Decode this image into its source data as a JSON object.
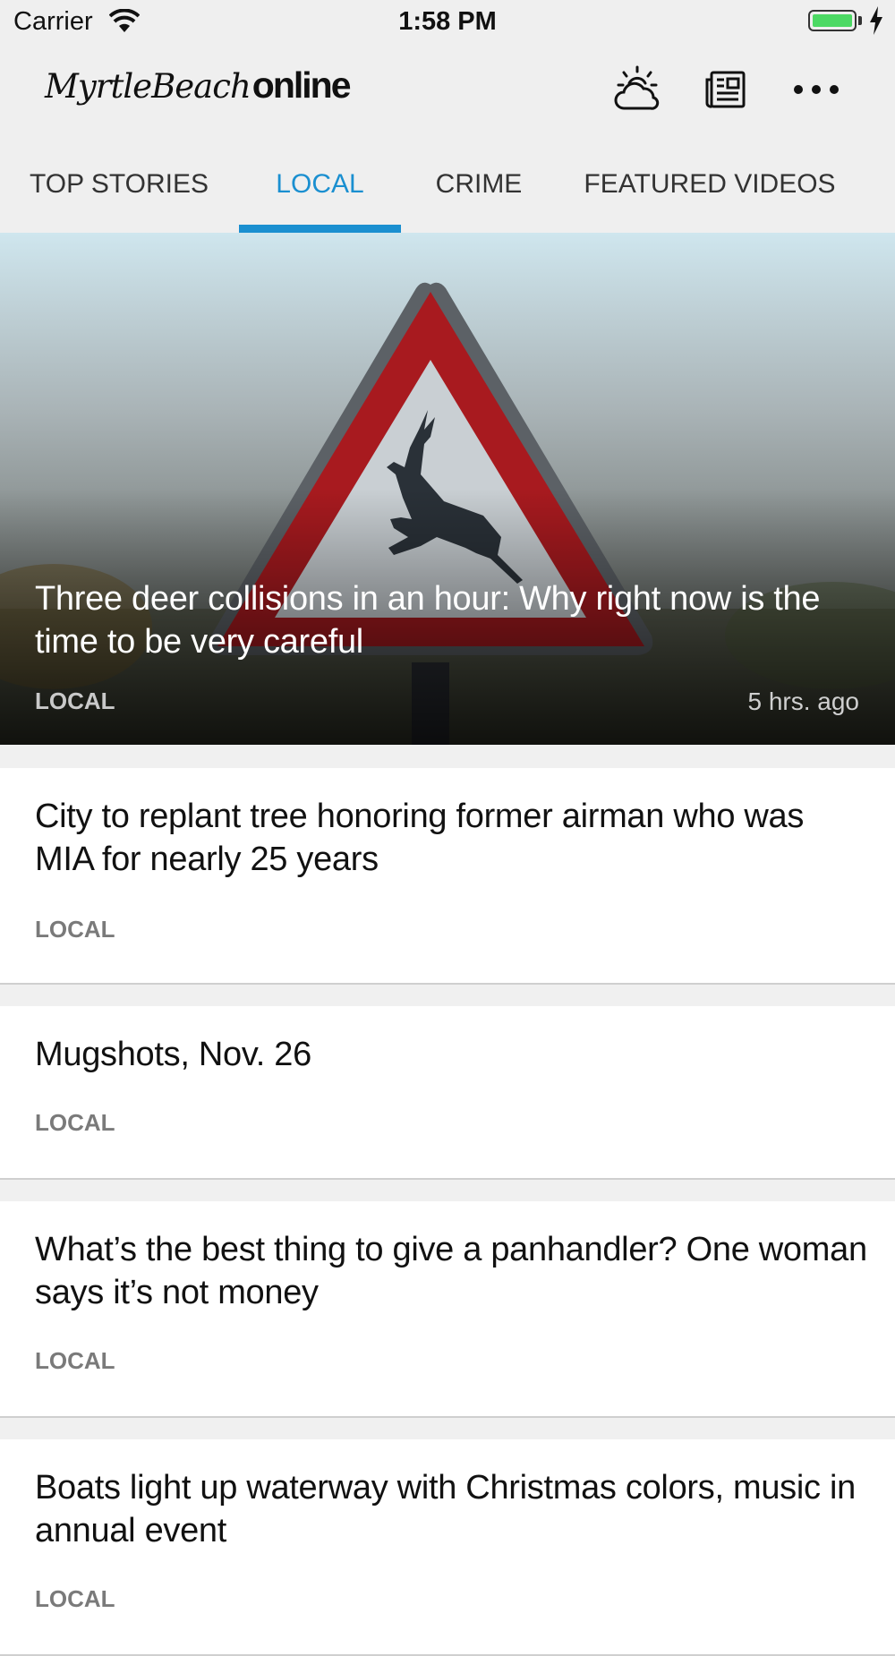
{
  "status_bar": {
    "carrier": "Carrier",
    "time": "1:58 PM"
  },
  "header": {
    "logo_script": "MyrtleBeach",
    "logo_bold": "online",
    "icons": [
      "weather-icon",
      "newspaper-icon",
      "more-icon"
    ]
  },
  "tabs": [
    {
      "label": "TOP STORIES",
      "active": false
    },
    {
      "label": "LOCAL",
      "active": true
    },
    {
      "label": "CRIME",
      "active": false
    },
    {
      "label": "FEATURED VIDEOS",
      "active": false
    }
  ],
  "accent_color": "#1a8fd0",
  "hero": {
    "title": "Three deer collisions in an hour: Why right now is the time to be very careful",
    "section": "LOCAL",
    "time": "5 hrs. ago"
  },
  "stories": [
    {
      "title": "City to replant tree honoring former airman who was MIA for nearly 25 years",
      "section": "LOCAL"
    },
    {
      "title": "Mugshots, Nov. 26",
      "section": "LOCAL"
    },
    {
      "title": "What’s the best thing to give a panhandler? One woman says it’s not money",
      "section": "LOCAL"
    },
    {
      "title": "Boats light up waterway with Christmas colors, music in annual event",
      "section": "LOCAL"
    }
  ]
}
